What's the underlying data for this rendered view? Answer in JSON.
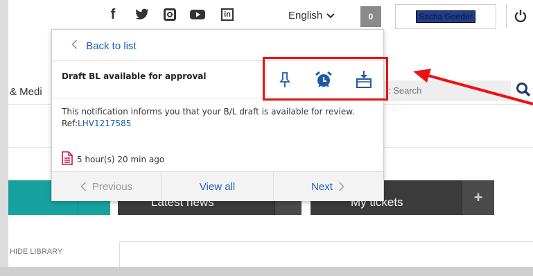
{
  "header": {
    "social": [
      {
        "icon": "facebook-icon",
        "glyph": "f"
      },
      {
        "icon": "twitter-icon"
      },
      {
        "icon": "instagram-icon"
      },
      {
        "icon": "youtube-icon"
      },
      {
        "icon": "linkedin-icon",
        "glyph": "in"
      }
    ],
    "language": "English",
    "notification_count": "0",
    "user_name": "Sacha Goeder"
  },
  "nav": {
    "partial_menu": "& Medi"
  },
  "search": {
    "placeholder": ": Search"
  },
  "notification": {
    "back_label": "Back to list",
    "title": "Draft BL available for approval",
    "body": "This notification informs you that your B/L draft is available for review.",
    "ref_prefix": "Ref:",
    "ref_value": "LHV1217585",
    "time_ago": "5 hour(s) 20 min ago",
    "actions": [
      "pin-icon",
      "alarm-clock-icon",
      "archive-icon"
    ],
    "footer": {
      "previous": "Previous",
      "view_all": "View all",
      "next": "Next"
    }
  },
  "tiles": [
    {
      "label": "",
      "plus": "+"
    },
    {
      "label": "Latest news",
      "plus": "+"
    },
    {
      "label": "My tickets",
      "plus": "+"
    }
  ],
  "library": {
    "hide_label": "HIDE LIBRARY"
  },
  "colors": {
    "accent_teal": "#17a2a0",
    "link_blue": "#1a5fb4",
    "annotation_red": "#ee1111",
    "dark_tile": "#3b3b3b"
  }
}
